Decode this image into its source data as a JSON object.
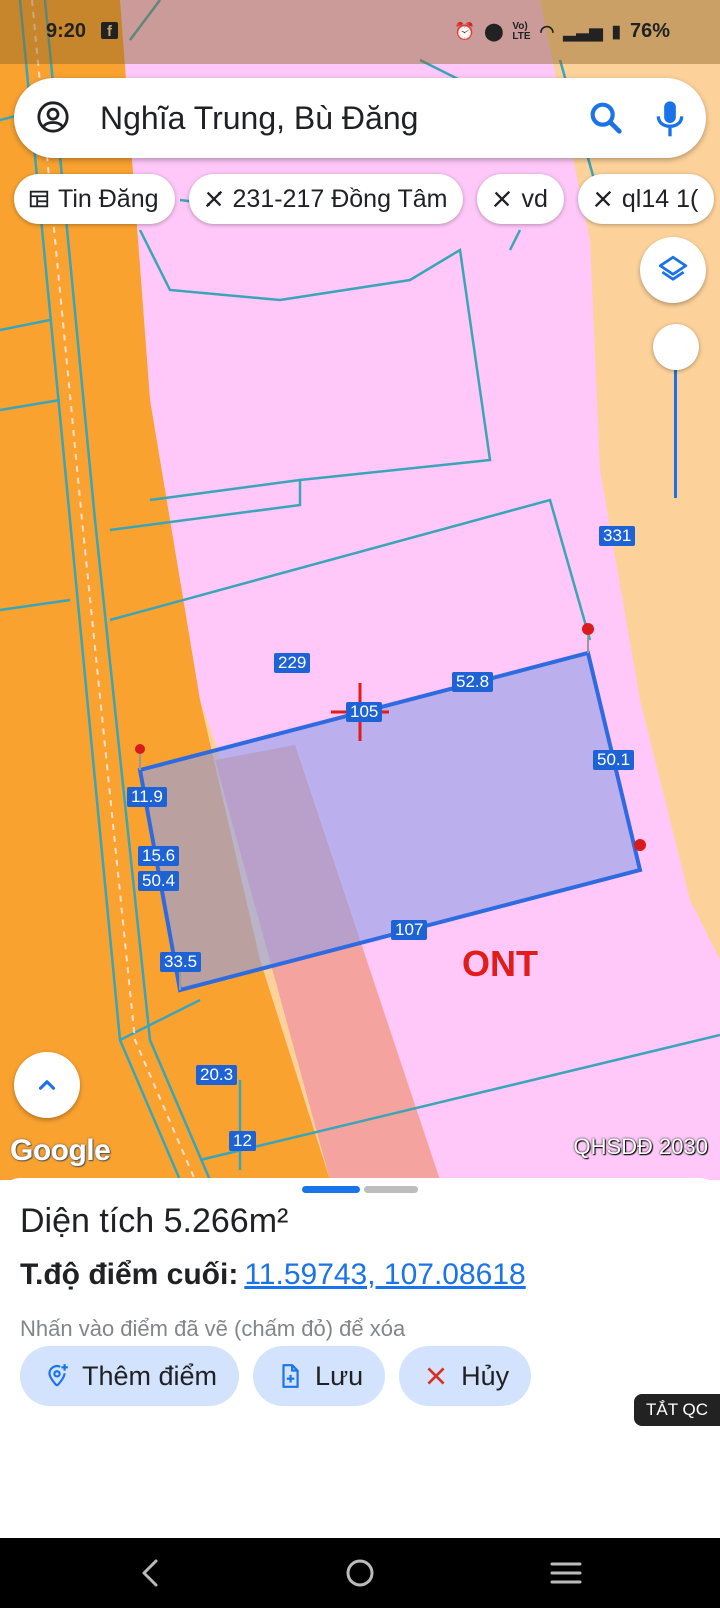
{
  "status_bar": {
    "time": "9:20",
    "app_notification_icon": "facebook-icon",
    "battery": "76%",
    "icons": [
      "alarm-icon",
      "location-icon",
      "volte-icon",
      "wifi-icon",
      "signal-icon",
      "battery-icon"
    ]
  },
  "search": {
    "value": "Nghĩa Trung, Bù Đăng",
    "left_icon": "account-circle-icon",
    "right_icons": [
      "search-icon",
      "mic-icon"
    ]
  },
  "chips": [
    {
      "label": "Tin Đăng",
      "icon": "table-icon"
    },
    {
      "label": "231-217 Đồng Tâm",
      "icon": "ruler-icon"
    },
    {
      "label": "vd",
      "icon": "ruler-icon"
    },
    {
      "label": "ql14  1(",
      "icon": "ruler-icon"
    }
  ],
  "map": {
    "parcel_numbers": [
      "331",
      "229",
      "105",
      "20.3",
      "12"
    ],
    "measure_labels": [
      "52.8",
      "50.1",
      "107",
      "11.9",
      "15.6",
      "50.4",
      "33.5"
    ],
    "zone_label": "ONT",
    "logo": "Google",
    "overlay_name": "QHSDĐ 2030",
    "colors": {
      "residential_zone": "#ffc8f8",
      "road_zone": "#f9a230",
      "farm_zone": "#fdd29a",
      "parcel_border": "#3aa5b8",
      "polygon_fill": "#8f9ee8",
      "polygon_stroke": "#2f6be0",
      "marker": "#d81b1b"
    }
  },
  "sheet": {
    "area": "Diện tích 5.266m²",
    "endpoint_label": "T.độ điểm cuối:",
    "endpoint_coords": "11.59743, 107.08618",
    "hint": "Nhấn vào điểm đã vẽ (chấm đỏ) để xóa",
    "buttons": {
      "add_point": "Thêm điểm",
      "save": "Lưu",
      "cancel": "Hủy"
    },
    "ads_tag": "TẮT QC"
  },
  "nav": {
    "buttons": [
      "back-icon",
      "home-icon",
      "recents-icon"
    ]
  }
}
